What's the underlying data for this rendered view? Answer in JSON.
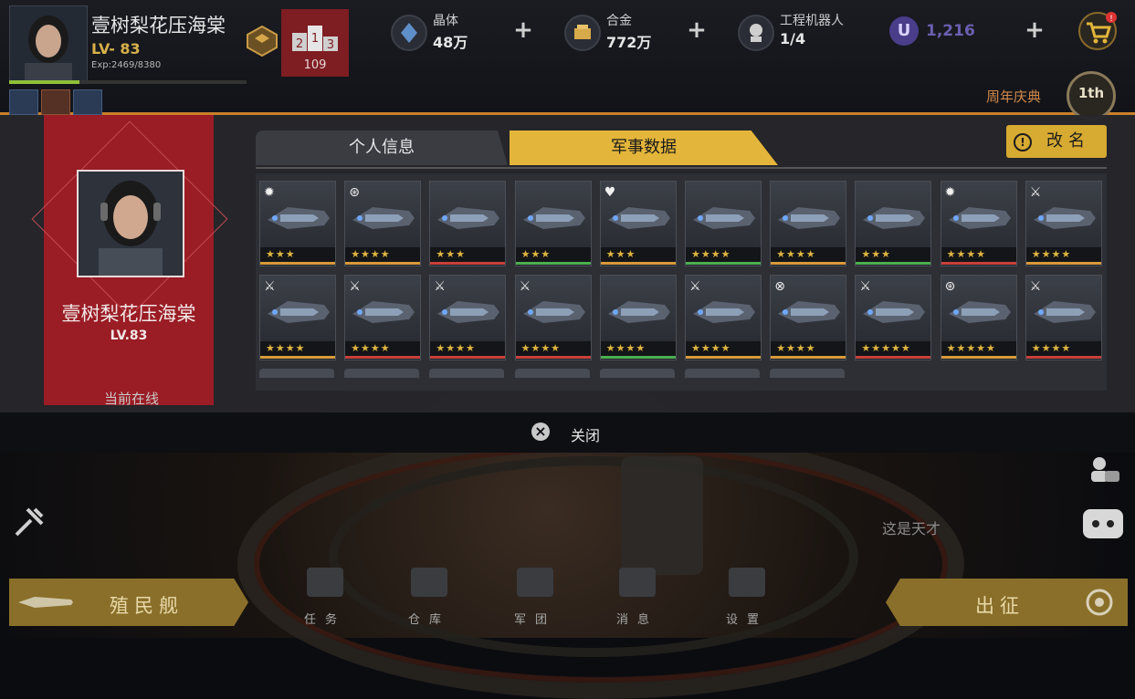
{
  "player": {
    "name": "壹树梨花压海棠",
    "level_text": "LV- 83",
    "exp_text": "Exp:2469/8380",
    "exp_progress": 0.295,
    "rank_positions": [
      "2",
      "1",
      "3"
    ],
    "rank_value": "109"
  },
  "resources": [
    {
      "label": "晶体",
      "value": "48万",
      "icon": "crystal-icon"
    },
    {
      "label": "合金",
      "value": "772万",
      "icon": "alloy-icon"
    },
    {
      "label": "工程机器人",
      "value": "1/4",
      "icon": "robot-icon"
    }
  ],
  "currency": {
    "value": "1,216",
    "icon": "u-coin-icon"
  },
  "event": {
    "label": "周年庆典",
    "badge": "1th"
  },
  "profile": {
    "name": "壹树梨花压海棠",
    "level": "LV.83",
    "status": "当前在线"
  },
  "tabs": [
    {
      "label": "个人信息",
      "active": false
    },
    {
      "label": "军事数据",
      "active": true
    }
  ],
  "rename_label": "改名",
  "close_label": "关闭",
  "ships": [
    {
      "stars": "★★★",
      "bar": "#d89a3a",
      "badge": "✹"
    },
    {
      "stars": "★★★★",
      "bar": "#d89a3a",
      "badge": "⊛"
    },
    {
      "stars": "★★★",
      "bar": "#c8403a",
      "badge": ""
    },
    {
      "stars": "★★★",
      "bar": "#4caf50",
      "badge": ""
    },
    {
      "stars": "★★★",
      "bar": "#d89a3a",
      "badge": "♥"
    },
    {
      "stars": "★★★★",
      "bar": "#4caf50",
      "badge": ""
    },
    {
      "stars": "★★★★",
      "bar": "#d89a3a",
      "badge": ""
    },
    {
      "stars": "★★★",
      "bar": "#4caf50",
      "badge": ""
    },
    {
      "stars": "★★★★",
      "bar": "#c8403a",
      "badge": "✹"
    },
    {
      "stars": "★★★★",
      "bar": "#d89a3a",
      "badge": "⚔"
    },
    {
      "stars": "★★★★",
      "bar": "#d89a3a",
      "badge": "⚔"
    },
    {
      "stars": "★★★★",
      "bar": "#c8403a",
      "badge": "⚔"
    },
    {
      "stars": "★★★★",
      "bar": "#c8403a",
      "badge": "⚔"
    },
    {
      "stars": "★★★★",
      "bar": "#c8403a",
      "badge": "⚔"
    },
    {
      "stars": "★★★★",
      "bar": "#4caf50",
      "badge": ""
    },
    {
      "stars": "★★★★",
      "bar": "#d89a3a",
      "badge": "⚔"
    },
    {
      "stars": "★★★★",
      "bar": "#d89a3a",
      "badge": "⊗"
    },
    {
      "stars": "★★★★★",
      "bar": "#c8403a",
      "badge": "⚔"
    },
    {
      "stars": "★★★★★",
      "bar": "#d89a3a",
      "badge": "⊛"
    },
    {
      "stars": "★★★★",
      "bar": "#c8403a",
      "badge": "⚔"
    }
  ],
  "chat_preview": "这是天才",
  "bottom_left_button": "殖民舰",
  "bottom_right_button": "出征",
  "nav": [
    {
      "label": "任务",
      "icon": "tasks-icon"
    },
    {
      "label": "仓库",
      "icon": "warehouse-icon"
    },
    {
      "label": "军团",
      "icon": "legion-icon"
    },
    {
      "label": "消息",
      "icon": "messages-icon"
    },
    {
      "label": "设置",
      "icon": "settings-icon"
    }
  ],
  "colors": {
    "accent": "#e3b53a",
    "profile_red": "#9a1c24",
    "online_bar": "#c9802a"
  }
}
